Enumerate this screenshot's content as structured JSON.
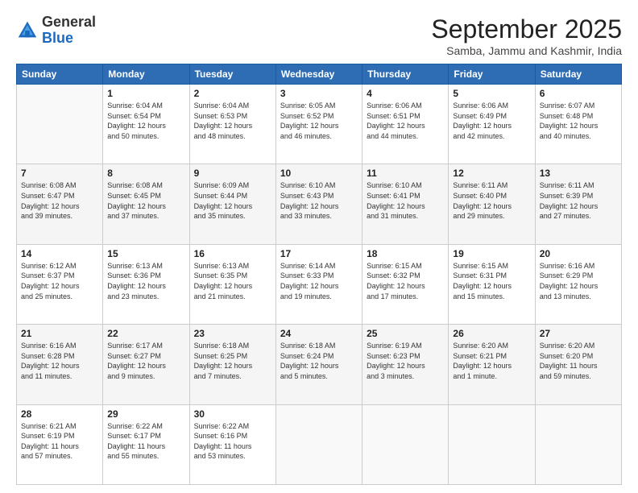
{
  "logo": {
    "general": "General",
    "blue": "Blue"
  },
  "header": {
    "month": "September 2025",
    "location": "Samba, Jammu and Kashmir, India"
  },
  "weekdays": [
    "Sunday",
    "Monday",
    "Tuesday",
    "Wednesday",
    "Thursday",
    "Friday",
    "Saturday"
  ],
  "weeks": [
    [
      {
        "day": "",
        "info": ""
      },
      {
        "day": "1",
        "info": "Sunrise: 6:04 AM\nSunset: 6:54 PM\nDaylight: 12 hours\nand 50 minutes."
      },
      {
        "day": "2",
        "info": "Sunrise: 6:04 AM\nSunset: 6:53 PM\nDaylight: 12 hours\nand 48 minutes."
      },
      {
        "day": "3",
        "info": "Sunrise: 6:05 AM\nSunset: 6:52 PM\nDaylight: 12 hours\nand 46 minutes."
      },
      {
        "day": "4",
        "info": "Sunrise: 6:06 AM\nSunset: 6:51 PM\nDaylight: 12 hours\nand 44 minutes."
      },
      {
        "day": "5",
        "info": "Sunrise: 6:06 AM\nSunset: 6:49 PM\nDaylight: 12 hours\nand 42 minutes."
      },
      {
        "day": "6",
        "info": "Sunrise: 6:07 AM\nSunset: 6:48 PM\nDaylight: 12 hours\nand 40 minutes."
      }
    ],
    [
      {
        "day": "7",
        "info": "Sunrise: 6:08 AM\nSunset: 6:47 PM\nDaylight: 12 hours\nand 39 minutes."
      },
      {
        "day": "8",
        "info": "Sunrise: 6:08 AM\nSunset: 6:45 PM\nDaylight: 12 hours\nand 37 minutes."
      },
      {
        "day": "9",
        "info": "Sunrise: 6:09 AM\nSunset: 6:44 PM\nDaylight: 12 hours\nand 35 minutes."
      },
      {
        "day": "10",
        "info": "Sunrise: 6:10 AM\nSunset: 6:43 PM\nDaylight: 12 hours\nand 33 minutes."
      },
      {
        "day": "11",
        "info": "Sunrise: 6:10 AM\nSunset: 6:41 PM\nDaylight: 12 hours\nand 31 minutes."
      },
      {
        "day": "12",
        "info": "Sunrise: 6:11 AM\nSunset: 6:40 PM\nDaylight: 12 hours\nand 29 minutes."
      },
      {
        "day": "13",
        "info": "Sunrise: 6:11 AM\nSunset: 6:39 PM\nDaylight: 12 hours\nand 27 minutes."
      }
    ],
    [
      {
        "day": "14",
        "info": "Sunrise: 6:12 AM\nSunset: 6:37 PM\nDaylight: 12 hours\nand 25 minutes."
      },
      {
        "day": "15",
        "info": "Sunrise: 6:13 AM\nSunset: 6:36 PM\nDaylight: 12 hours\nand 23 minutes."
      },
      {
        "day": "16",
        "info": "Sunrise: 6:13 AM\nSunset: 6:35 PM\nDaylight: 12 hours\nand 21 minutes."
      },
      {
        "day": "17",
        "info": "Sunrise: 6:14 AM\nSunset: 6:33 PM\nDaylight: 12 hours\nand 19 minutes."
      },
      {
        "day": "18",
        "info": "Sunrise: 6:15 AM\nSunset: 6:32 PM\nDaylight: 12 hours\nand 17 minutes."
      },
      {
        "day": "19",
        "info": "Sunrise: 6:15 AM\nSunset: 6:31 PM\nDaylight: 12 hours\nand 15 minutes."
      },
      {
        "day": "20",
        "info": "Sunrise: 6:16 AM\nSunset: 6:29 PM\nDaylight: 12 hours\nand 13 minutes."
      }
    ],
    [
      {
        "day": "21",
        "info": "Sunrise: 6:16 AM\nSunset: 6:28 PM\nDaylight: 12 hours\nand 11 minutes."
      },
      {
        "day": "22",
        "info": "Sunrise: 6:17 AM\nSunset: 6:27 PM\nDaylight: 12 hours\nand 9 minutes."
      },
      {
        "day": "23",
        "info": "Sunrise: 6:18 AM\nSunset: 6:25 PM\nDaylight: 12 hours\nand 7 minutes."
      },
      {
        "day": "24",
        "info": "Sunrise: 6:18 AM\nSunset: 6:24 PM\nDaylight: 12 hours\nand 5 minutes."
      },
      {
        "day": "25",
        "info": "Sunrise: 6:19 AM\nSunset: 6:23 PM\nDaylight: 12 hours\nand 3 minutes."
      },
      {
        "day": "26",
        "info": "Sunrise: 6:20 AM\nSunset: 6:21 PM\nDaylight: 12 hours\nand 1 minute."
      },
      {
        "day": "27",
        "info": "Sunrise: 6:20 AM\nSunset: 6:20 PM\nDaylight: 11 hours\nand 59 minutes."
      }
    ],
    [
      {
        "day": "28",
        "info": "Sunrise: 6:21 AM\nSunset: 6:19 PM\nDaylight: 11 hours\nand 57 minutes."
      },
      {
        "day": "29",
        "info": "Sunrise: 6:22 AM\nSunset: 6:17 PM\nDaylight: 11 hours\nand 55 minutes."
      },
      {
        "day": "30",
        "info": "Sunrise: 6:22 AM\nSunset: 6:16 PM\nDaylight: 11 hours\nand 53 minutes."
      },
      {
        "day": "",
        "info": ""
      },
      {
        "day": "",
        "info": ""
      },
      {
        "day": "",
        "info": ""
      },
      {
        "day": "",
        "info": ""
      }
    ]
  ]
}
